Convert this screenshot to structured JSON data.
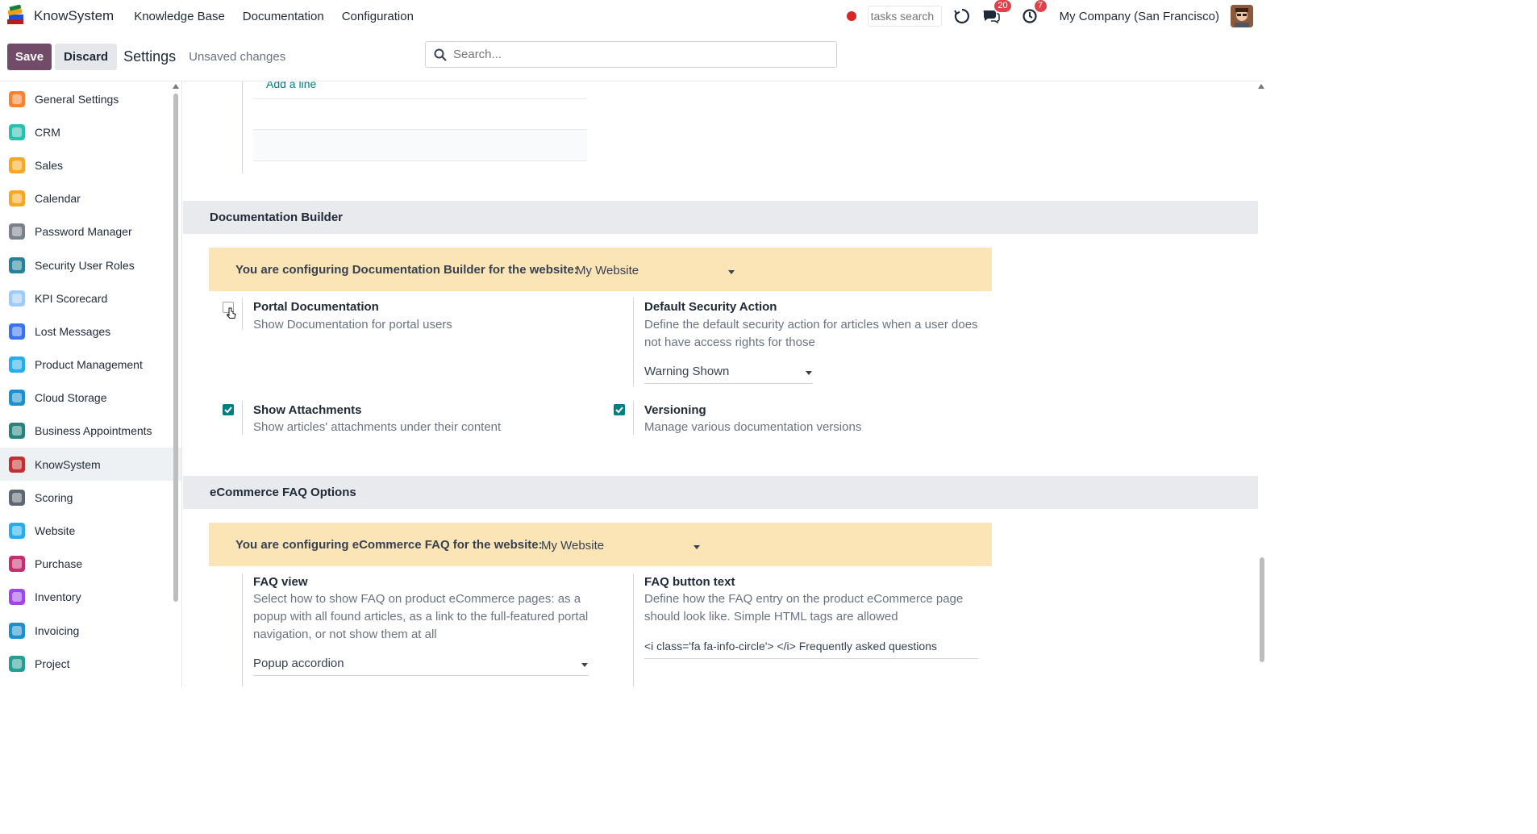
{
  "navbar": {
    "brand": "KnowSystem",
    "menu": [
      "Knowledge Base",
      "Documentation",
      "Configuration"
    ],
    "tasks_search_placeholder": "tasks search",
    "messages_count": "20",
    "activities_count": "7",
    "company": "My Company (San Francisco)"
  },
  "control_panel": {
    "save_label": "Save",
    "discard_label": "Discard",
    "title": "Settings",
    "status": "Unsaved changes",
    "search_placeholder": "Search..."
  },
  "sidebar": {
    "items": [
      {
        "label": "General Settings",
        "icon": "general-settings-icon",
        "color": "#f97316"
      },
      {
        "label": "CRM",
        "icon": "crm-icon",
        "color": "#14b8a6"
      },
      {
        "label": "Sales",
        "icon": "sales-icon",
        "color": "#f59e0b"
      },
      {
        "label": "Calendar",
        "icon": "calendar-icon",
        "color": "#f59e0b"
      },
      {
        "label": "Password Manager",
        "icon": "password-manager-icon",
        "color": "#6b7280"
      },
      {
        "label": "Security User Roles",
        "icon": "security-user-roles-icon",
        "color": "#0e7490"
      },
      {
        "label": "KPI Scorecard",
        "icon": "kpi-scorecard-icon",
        "color": "#93c5fd"
      },
      {
        "label": "Lost Messages",
        "icon": "lost-messages-icon",
        "color": "#2563eb"
      },
      {
        "label": "Product Management",
        "icon": "product-management-icon",
        "color": "#0ea5e9"
      },
      {
        "label": "Cloud Storage",
        "icon": "cloud-storage-icon",
        "color": "#0284c7"
      },
      {
        "label": "Business Appointments",
        "icon": "business-appointments-icon",
        "color": "#0f766e"
      },
      {
        "label": "KnowSystem",
        "icon": "knowsystem-icon",
        "color": "#b91c1c",
        "active": true
      },
      {
        "label": "Scoring",
        "icon": "scoring-icon",
        "color": "#4b5563"
      },
      {
        "label": "Website",
        "icon": "website-icon",
        "color": "#0ea5e9"
      },
      {
        "label": "Purchase",
        "icon": "purchase-icon",
        "color": "#be185d"
      },
      {
        "label": "Inventory",
        "icon": "inventory-icon",
        "color": "#9333ea"
      },
      {
        "label": "Invoicing",
        "icon": "invoicing-icon",
        "color": "#0284c7"
      },
      {
        "label": "Project",
        "icon": "project-icon",
        "color": "#0d9488"
      }
    ]
  },
  "main": {
    "add_line": "Add a line",
    "doc_builder": {
      "section_title": "Documentation Builder",
      "website_label": "You are configuring Documentation Builder for the website:",
      "website_value": "My Website",
      "portal_docs": {
        "title": "Portal Documentation",
        "desc": "Show Documentation for portal users",
        "checked": false
      },
      "default_security": {
        "title": "Default Security Action",
        "desc_line1": "Define the default security action for articles when a user does",
        "desc_line2": "not have access rights for those",
        "value": "Warning Shown"
      },
      "show_attachments": {
        "title": "Show Attachments",
        "desc": "Show articles' attachments under their content",
        "checked": true
      },
      "versioning": {
        "title": "Versioning",
        "desc": "Manage various documentation versions",
        "checked": true
      }
    },
    "ecommerce_faq": {
      "section_title": "eCommerce FAQ Options",
      "website_label": "You are configuring eCommerce FAQ for the website:",
      "website_value": "My Website",
      "faq_view": {
        "title": "FAQ view",
        "desc_line1": "Select how to show FAQ on product eCommerce pages: as a",
        "desc_line2": "popup with all found articles, as a link to the full-featured portal",
        "desc_line3": "navigation, or not show them at all",
        "value": "Popup accordion"
      },
      "faq_button": {
        "title": "FAQ button text",
        "desc_line1": "Define how the FAQ entry on the product eCommerce page",
        "desc_line2": "should look like. Simple HTML tags are allowed",
        "value": "<i class='fa fa-info-circle'> </i> Frequently asked questions"
      }
    }
  },
  "colors": {
    "primary": "#714b67",
    "teal": "#017e84",
    "website_bar": "#fbe5b6",
    "section_bg": "#e8eaed"
  }
}
